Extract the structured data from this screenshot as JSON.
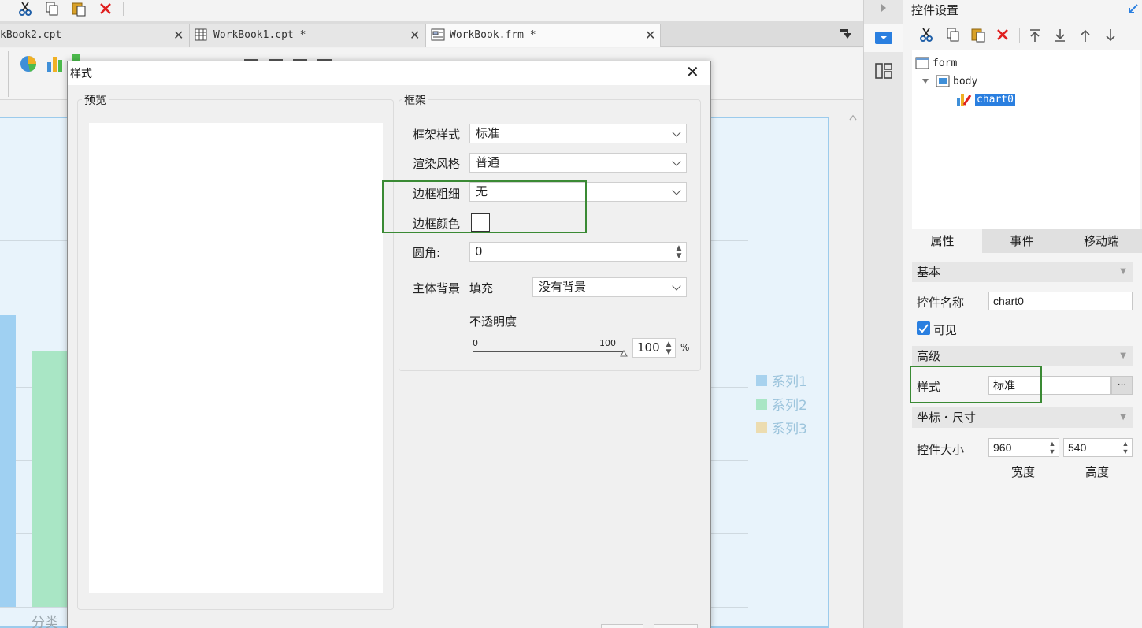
{
  "tabs": [
    {
      "label": "kBook2.cpt"
    },
    {
      "label": "WorkBook1.cpt *"
    },
    {
      "label": "WorkBook.frm *"
    }
  ],
  "chart": {
    "legend": [
      "系列1",
      "系列2",
      "系列3"
    ],
    "legend_colors": [
      "#a8d2ee",
      "#a9e6c5",
      "#ecdcb0"
    ],
    "x_axis_label": "分类"
  },
  "panel": {
    "title": "控件设置",
    "tree": {
      "root": "form",
      "body": "body",
      "selected": "chart0"
    },
    "tabs": [
      "属性",
      "事件",
      "移动端"
    ],
    "groups": {
      "basic": "基本",
      "advanced": "高级",
      "coords": "坐标・尺寸"
    },
    "control_name_label": "控件名称",
    "control_name_value": "chart0",
    "visible_label": "可见",
    "style_label": "样式",
    "style_value": "标准",
    "style_more": "···",
    "size_label": "控件大小",
    "width_value": "960",
    "height_value": "540",
    "width_label": "宽度",
    "height_label": "高度"
  },
  "dialog": {
    "title": "样式",
    "preview_title": "预览",
    "frame_title": "框架",
    "frame_style_label": "框架样式",
    "frame_style_value": "标准",
    "render_label": "渲染风格",
    "render_value": "普通",
    "border_width_label": "边框粗细",
    "border_width_value": "无",
    "border_color_label": "边框颜色",
    "radius_label": "圆角:",
    "radius_value": "0",
    "bg_label": "主体背景",
    "fill_label": "填充",
    "bg_value": "没有背景",
    "opacity_label": "不透明度",
    "opacity_min": "0",
    "opacity_max": "100",
    "opacity_value": "100",
    "opacity_unit": "%"
  },
  "colors": {
    "highlight": "#3a8a34",
    "selection": "#2a7fe0"
  }
}
